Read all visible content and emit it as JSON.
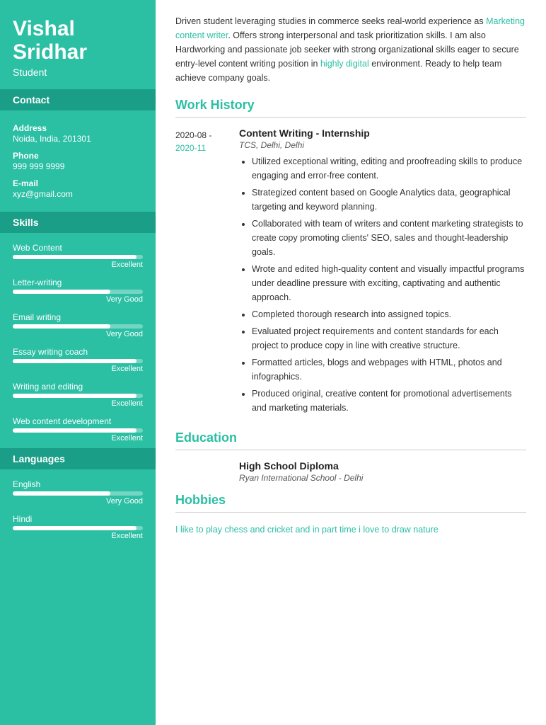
{
  "sidebar": {
    "name_line1": "Vishal",
    "name_line2": "Sridhar",
    "role": "Student",
    "contact_title": "Contact",
    "contact": {
      "address_label": "Address",
      "address_value": "Noida, India, 201301",
      "phone_label": "Phone",
      "phone_value": "999 999 9999",
      "email_label": "E-mail",
      "email_value": "xyz@gmail.com"
    },
    "skills_title": "Skills",
    "skills": [
      {
        "name": "Web Content",
        "level": "Excellent",
        "pct": 95
      },
      {
        "name": "Letter-writing",
        "level": "Very Good",
        "pct": 75
      },
      {
        "name": "Email writing",
        "level": "Very Good",
        "pct": 75
      },
      {
        "name": "Essay writing coach",
        "level": "Excellent",
        "pct": 95
      },
      {
        "name": "Writing and editing",
        "level": "Excellent",
        "pct": 95
      },
      {
        "name": "Web content development",
        "level": "Excellent",
        "pct": 95
      }
    ],
    "languages_title": "Languages",
    "languages": [
      {
        "name": "English",
        "level": "Very Good",
        "pct": 75
      },
      {
        "name": "Hindi",
        "level": "Excellent",
        "pct": 95
      }
    ]
  },
  "summary": {
    "text_plain": "Driven student leveraging studies in commerce seeks real-world experience as ",
    "link1": "Marketing content writer",
    "text2": ". Offers strong interpersonal and task prioritization skills. I am also Hardworking and passionate job seeker with strong organizational skills eager to secure entry-level content writing position in ",
    "link2": "highly digital",
    "text3": " environment. Ready to help team achieve company goals."
  },
  "work_history": {
    "section_title": "Work History",
    "entries": [
      {
        "date_start": "2020-08 -",
        "date_end": "2020-11",
        "job_title": "Content Writing - Internship",
        "company": "TCS, Delhi, Delhi",
        "bullets": [
          "Utilized exceptional writing, editing and proofreading skills to produce engaging and error-free content.",
          "Strategized content based on Google Analytics data, geographical targeting and keyword planning.",
          "Collaborated with team of writers and content marketing strategists to create copy promoting clients' SEO, sales and thought-leadership goals.",
          "Wrote and edited high-quality content and visually impactful programs under deadline pressure with exciting, captivating and authentic approach.",
          "Completed thorough research into assigned topics.",
          "Evaluated project requirements and content standards for each project to produce copy in line with creative structure.",
          "Formatted articles, blogs and webpages with HTML, photos and infographics.",
          "Produced original, creative content for promotional advertisements and marketing materials."
        ]
      }
    ]
  },
  "education": {
    "section_title": "Education",
    "entries": [
      {
        "degree": "High School Diploma",
        "school": "Ryan International School - Delhi"
      }
    ]
  },
  "hobbies": {
    "section_title": "Hobbies",
    "text": "I like to play chess and cricket and in part time i love to draw nature"
  }
}
